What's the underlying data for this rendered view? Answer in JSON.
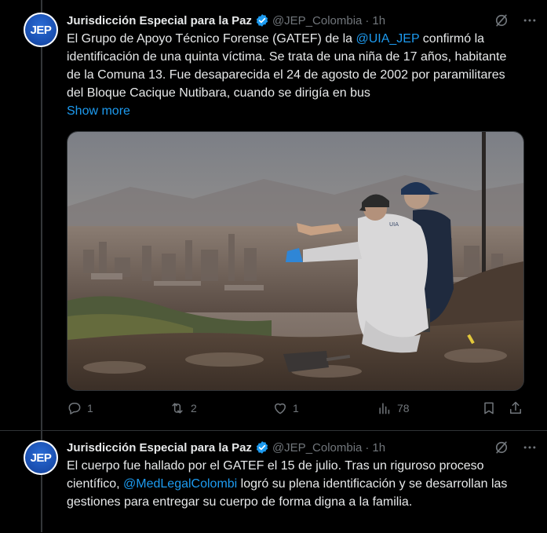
{
  "colors": {
    "accent": "#1d9bf0",
    "muted": "#71767b",
    "text": "#e7e9ea",
    "background": "#000000"
  },
  "tweets": [
    {
      "avatar_text": "JEP",
      "author_name": "Jurisdicción Especial para la Paz",
      "handle": "@JEP_Colombia",
      "separator": "·",
      "time": "1h",
      "text_before_mention": "El Grupo de Apoyo Técnico Forense (GATEF) de la ",
      "mention": "@UIA_JEP",
      "text_after_mention": " confirmó la identificación de una quinta víctima. Se trata de una niña de 17 años, habitante de la Comuna 13. Fue desaparecida el 24 de agosto de 2002 por paramilitares del Bloque Cacique Nutibara, cuando se dirigía en bus",
      "show_more": "Show more",
      "image_label": "UIA",
      "stats": {
        "replies": "1",
        "reposts": "2",
        "likes": "1",
        "views": "78"
      }
    },
    {
      "avatar_text": "JEP",
      "author_name": "Jurisdicción Especial para la Paz",
      "handle": "@JEP_Colombia",
      "separator": "·",
      "time": "1h",
      "text_before_mention": "El cuerpo fue hallado por el GATEF el 15 de julio. Tras un riguroso proceso científico, ",
      "mention": "@MedLegalColombi",
      "text_after_mention": " logró su plena identificación y se desarrollan las gestiones para entregar su cuerpo de forma digna a la familia."
    }
  ],
  "icons": {
    "verified": "verified-badge-icon",
    "grok": "grok-icon",
    "more": "more-icon",
    "reply": "reply-icon",
    "repost": "repost-icon",
    "like": "heart-icon",
    "views": "views-icon",
    "bookmark": "bookmark-icon",
    "share": "share-icon"
  }
}
